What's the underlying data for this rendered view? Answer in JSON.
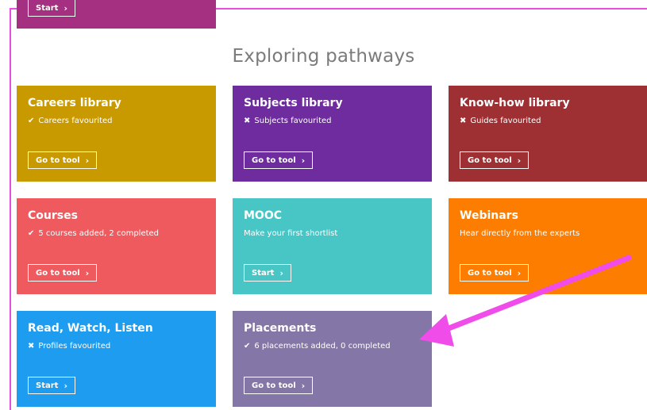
{
  "page": {
    "heading": "Exploring pathways",
    "top_tile": {
      "button": "Start",
      "color": "#a53081"
    }
  },
  "tiles": [
    {
      "title": "Careers library",
      "status_icon": "check-icon",
      "status_mark": "✔",
      "status": "Careers favourited",
      "button": "Go to tool",
      "color": "#c99a00"
    },
    {
      "title": "Subjects library",
      "status_icon": "cross-icon",
      "status_mark": "✖",
      "status": "Subjects favourited",
      "button": "Go to tool",
      "color": "#6e2c9e"
    },
    {
      "title": "Know-how library",
      "status_icon": "cross-icon",
      "status_mark": "✖",
      "status": "Guides favourited",
      "button": "Go to tool",
      "color": "#9e2f32"
    },
    {
      "title": "Courses",
      "status_icon": "check-icon",
      "status_mark": "✔",
      "status": "5 courses added, 2 completed",
      "button": "Go to tool",
      "color": "#ee5a5e"
    },
    {
      "title": "MOOC",
      "status_icon": "",
      "status_mark": "",
      "status": "Make your first shortlist",
      "button": "Start",
      "color": "#48c6c6"
    },
    {
      "title": "Webinars",
      "status_icon": "",
      "status_mark": "",
      "status": "Hear directly from the experts",
      "button": "Go to tool",
      "color": "#fd7d01"
    },
    {
      "title": "Read, Watch, Listen",
      "status_icon": "cross-icon",
      "status_mark": "✖",
      "status": "Profiles favourited",
      "button": "Start",
      "color": "#1e9cf0"
    },
    {
      "title": "Placements",
      "status_icon": "check-icon",
      "status_mark": "✔",
      "status": "6 placements added, 0 completed",
      "button": "Go to tool",
      "color": "#8476a6"
    }
  ],
  "annotation": {
    "arrow_color": "#ef4ce9"
  }
}
